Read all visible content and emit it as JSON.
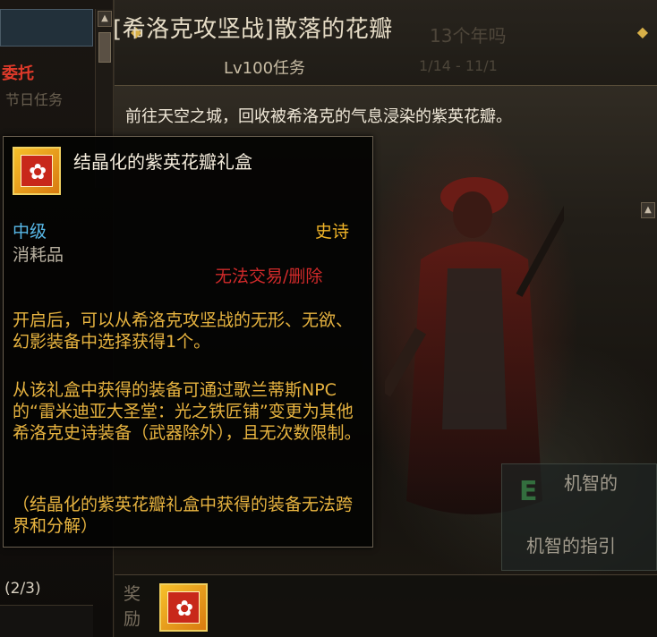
{
  "left_panel": {
    "commission_label": "委托",
    "faded_label": "节日任务",
    "progress": "(2/3)",
    "scroll_up_icon": "caret-up-icon"
  },
  "quest": {
    "title": "[希洛克攻坚战]散落的花瓣",
    "level": "Lv100任务",
    "description": "前往天空之城，回收被希洛克的气息浸染的紫英花瓣。",
    "nav_left_icon": "arrow-left-icon",
    "nav_right_icon": "arrow-right-icon",
    "faded_text": "13个年吗",
    "faded_text_2": "1/14 - 11/1"
  },
  "reward": {
    "label": "奖励"
  },
  "tooltip": {
    "item_name": "结晶化的紫英花瓣礼盒",
    "grade": "中级",
    "rarity": "史诗",
    "type": "消耗品",
    "trade": "无法交易/删除",
    "description_1": "开启后，可以从希洛克攻坚战的无形、无欲、幻影装备中选择获得1个。",
    "description_2": "从该礼盒中获得的装备可通过歌兰蒂斯NPC的“雷米迪亚大圣堂：光之铁匠铺”变更为其他希洛克史诗装备（武器除外），且无次数限制。",
    "description_3": "（结晶化的紫英花瓣礼盒中获得的装备无法跨界和分解）"
  },
  "right_side": {
    "item_1": "机智的",
    "item_2": "机智的指引",
    "e_badge": "E"
  },
  "colors": {
    "grade": "#58b8e8",
    "rarity": "#f0b428",
    "trade": "#d02a2a",
    "desc": "#e8b440",
    "commission": "#e03a2a"
  }
}
